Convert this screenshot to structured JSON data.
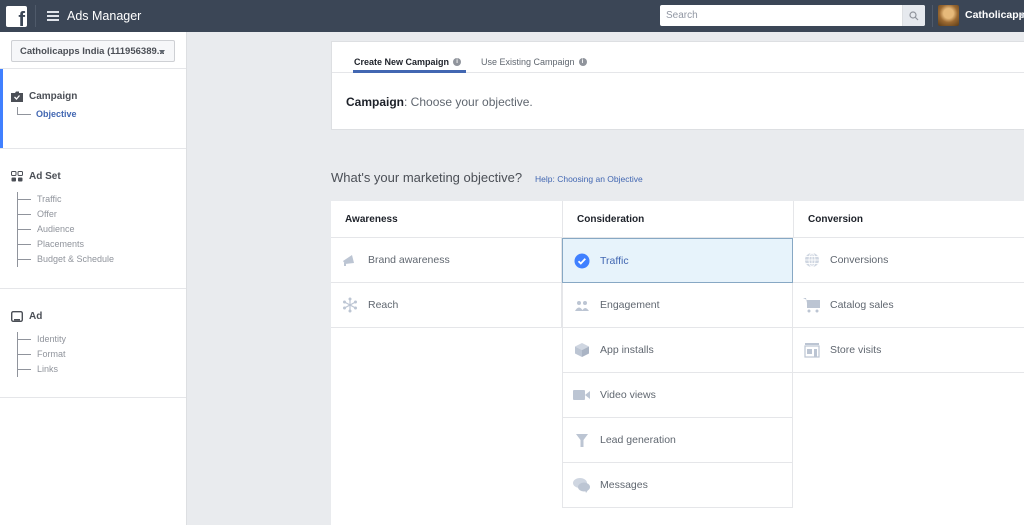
{
  "topbar": {
    "logo": "f",
    "app_title": "Ads Manager",
    "search_placeholder": "Search",
    "user_name": "Catholicapps"
  },
  "sidebar": {
    "account_selector": "Catholicapps India (111956389...",
    "sections": [
      {
        "title": "Campaign",
        "icon": "campaign-icon",
        "items": [
          {
            "label": "Objective",
            "active": true
          }
        ]
      },
      {
        "title": "Ad Set",
        "icon": "adset-grid-icon",
        "items": [
          {
            "label": "Traffic"
          },
          {
            "label": "Offer"
          },
          {
            "label": "Audience"
          },
          {
            "label": "Placements"
          },
          {
            "label": "Budget & Schedule"
          }
        ]
      },
      {
        "title": "Ad",
        "icon": "ad-monitor-icon",
        "items": [
          {
            "label": "Identity"
          },
          {
            "label": "Format"
          },
          {
            "label": "Links"
          }
        ]
      }
    ]
  },
  "main": {
    "tabs": [
      {
        "label": "Create New Campaign",
        "active": true
      },
      {
        "label": "Use Existing Campaign",
        "active": false
      }
    ],
    "campaign_label": "Campaign",
    "campaign_text": ": Choose your objective.",
    "question": "What's your marketing objective?",
    "help_link": "Help: Choosing an Objective",
    "columns": [
      {
        "title": "Awareness",
        "items": [
          {
            "label": "Brand awareness",
            "icon": "megaphone-icon"
          },
          {
            "label": "Reach",
            "icon": "reach-icon"
          }
        ]
      },
      {
        "title": "Consideration",
        "items": [
          {
            "label": "Traffic",
            "icon": "check-circle-icon",
            "selected": true
          },
          {
            "label": "Engagement",
            "icon": "people-icon"
          },
          {
            "label": "App installs",
            "icon": "box-icon"
          },
          {
            "label": "Video views",
            "icon": "video-camera-icon"
          },
          {
            "label": "Lead generation",
            "icon": "funnel-icon"
          },
          {
            "label": "Messages",
            "icon": "chat-bubbles-icon"
          }
        ]
      },
      {
        "title": "Conversion",
        "items": [
          {
            "label": "Conversions",
            "icon": "globe-icon"
          },
          {
            "label": "Catalog sales",
            "icon": "cart-icon"
          },
          {
            "label": "Store visits",
            "icon": "store-icon"
          }
        ]
      }
    ]
  },
  "colors": {
    "topbar": "#3b4656",
    "accent": "#4267b2",
    "selected_bg": "#e7f3fb",
    "sidebar_active": "#4080ff",
    "icon_gray": "#bcc5d3"
  }
}
